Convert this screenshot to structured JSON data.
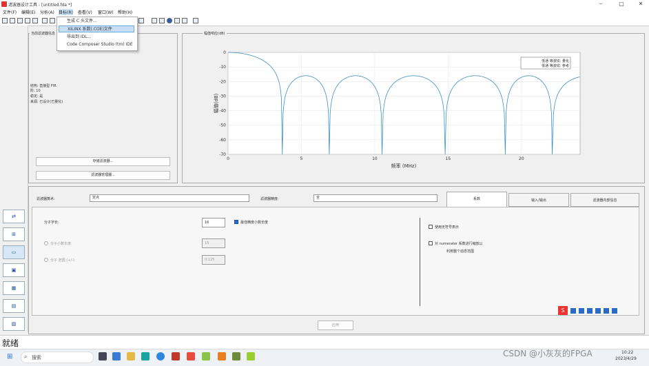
{
  "window": {
    "title": "滤波器设计工具 - [untitled.fda *]",
    "min": "–",
    "max": "▢",
    "close": "✕"
  },
  "menu": [
    "文件(F)",
    "编辑(E)",
    "分析(A)",
    "目标(R)",
    "查看(V)",
    "窗口(W)",
    "帮助(H)"
  ],
  "target_menu": {
    "items": [
      "生成 C 头文件...",
      "XILINX 系数(.COE)文件",
      "导出到 IDL...",
      "Code Composer Studio (tm) IDE"
    ],
    "selected_index": 1
  },
  "filter_info": {
    "title": "当前滤波器信息",
    "rows": [
      "结构: 直接型 FIR",
      "阶: 10",
      "稳定: 是",
      "来源: 已设计(已量化)"
    ],
    "store_button": "存储滤波器...",
    "manager_button": "滤波器管理器..."
  },
  "chart_panel": {
    "title": "幅值响应(dB)"
  },
  "chart_data": {
    "type": "line",
    "xlabel": "频率 (MHz)",
    "ylabel": "幅值(dB)",
    "xlim": [
      0,
      24
    ],
    "ylim": [
      -70,
      0
    ],
    "xticks": [
      "0",
      "5",
      "10",
      "15",
      "20"
    ],
    "yticks": [
      "0",
      "-10",
      "-20",
      "-30",
      "-40",
      "-50",
      "-60",
      "-70"
    ],
    "nulls_mhz": [
      3.7,
      6.9,
      10.5,
      14.8,
      18.9,
      22.1
    ],
    "sidelobe_peak_db": -16,
    "legend": [
      "低通 等波纹: 量化",
      "低通 等波纹: 参考"
    ],
    "legend_position": "top-right",
    "color": "#3d8fc4"
  },
  "settings": {
    "arith_label": "滤波器算术:",
    "arith_value": "定点",
    "precision_label": "滤波器精度:",
    "precision_value": "全",
    "tabs": [
      "系数",
      "输入/输出",
      "滤波器内部信息"
    ],
    "numerator_wordlength_label": "分子字长:",
    "numerator_wordlength_value": "16",
    "best_precision_label": "最佳精度小数长度",
    "numerator_frac_label": "分子小数长度:",
    "numerator_frac_value": "15",
    "numerator_range_label": "分子 范围 (+/-):",
    "numerator_range_value": "0.125",
    "unsigned_label": "使用无符号表示",
    "scale_label1": "对 numerator 系数进行缩放以",
    "scale_label2": "利用整个动态范围",
    "apply_button": "应用"
  },
  "status": "就绪",
  "taskbar": {
    "search": "搜索",
    "time": "10:22",
    "date": "2023/4/29",
    "watermark": "CSDN @小灰灰的FPGA"
  }
}
